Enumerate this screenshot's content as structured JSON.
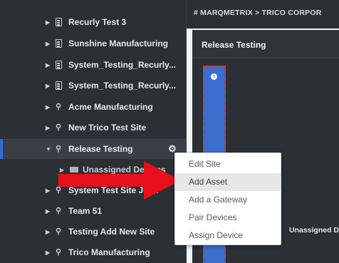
{
  "header": {
    "breadcrumb": "# MARQMETRIX > TRICO CORPOR"
  },
  "sidebar": {
    "items": [
      {
        "label": "Recurly Test 3",
        "icon": "building-icon"
      },
      {
        "label": "Sunshine Manufacturing",
        "icon": "building-icon"
      },
      {
        "label": "System_Testing_Recurly...",
        "icon": "building-icon"
      },
      {
        "label": "System_Testing_Recurly...",
        "icon": "building-icon"
      },
      {
        "label": "Acme Manufacturing",
        "icon": "map-pin-icon"
      },
      {
        "label": "New Trico Test Site",
        "icon": "map-pin-icon"
      },
      {
        "label": "Release Testing",
        "icon": "map-pin-icon",
        "selected": true
      },
      {
        "label": "Unassigned Devices",
        "icon": "folder-icon"
      },
      {
        "label": "System Test Site Justi",
        "icon": "map-pin-icon"
      },
      {
        "label": "Team 51",
        "icon": "map-pin-icon"
      },
      {
        "label": "Testing Add New Site",
        "icon": "map-pin-icon"
      },
      {
        "label": "Trico Manufacturing",
        "icon": "map-pin-icon"
      }
    ]
  },
  "main": {
    "panel_title": "Release Testing",
    "unassigned_label": "Unassigned D",
    "info_icon_glyph": "i"
  },
  "context_menu": {
    "items": [
      {
        "label": "Edit Site"
      },
      {
        "label": "Add Asset",
        "highlighted": true
      },
      {
        "label": "Add a Gateway"
      },
      {
        "label": "Pair Devices"
      },
      {
        "label": "Assign Device"
      }
    ]
  },
  "colors": {
    "sidebar_bg": "#2b3035",
    "accent_blue": "#3a6fd0",
    "annotation_red": "#e8101a",
    "selection_bar": "#2e6ddb"
  }
}
